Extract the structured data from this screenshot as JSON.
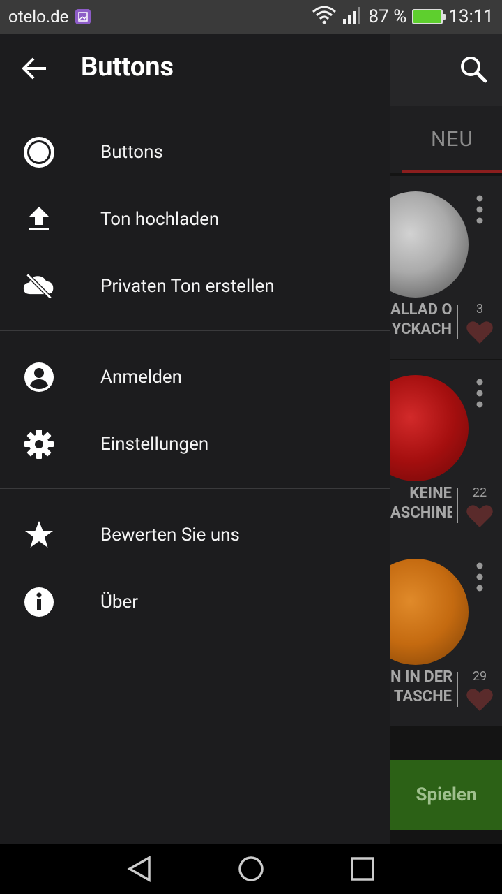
{
  "status_bar": {
    "carrier": "otelo.de",
    "battery": "87 %",
    "time": "13:11"
  },
  "drawer": {
    "title": "Buttons",
    "items": [
      {
        "label": "Buttons",
        "icon": "circle-button-icon"
      },
      {
        "label": "Ton hochladen",
        "icon": "upload-icon"
      },
      {
        "label": "Privaten Ton erstellen",
        "icon": "cloud-off-icon"
      },
      {
        "label": "Anmelden",
        "icon": "account-circle-icon"
      },
      {
        "label": "Einstellungen",
        "icon": "gear-icon"
      },
      {
        "label": "Bewerten Sie uns",
        "icon": "star-icon"
      },
      {
        "label": "Über",
        "icon": "info-icon"
      }
    ]
  },
  "background": {
    "tab_label": "NEU",
    "cards": [
      {
        "label": "ALLAD O\nYCKACH",
        "likes": "3",
        "color": "#9a9a9a"
      },
      {
        "label": "KEINE\nASCHINE",
        "likes": "22",
        "color": "#a50f0f"
      },
      {
        "label": "N IN DER\nTASCHE",
        "likes": "29",
        "color": "#c46a10"
      }
    ],
    "play_label": "Spielen"
  }
}
